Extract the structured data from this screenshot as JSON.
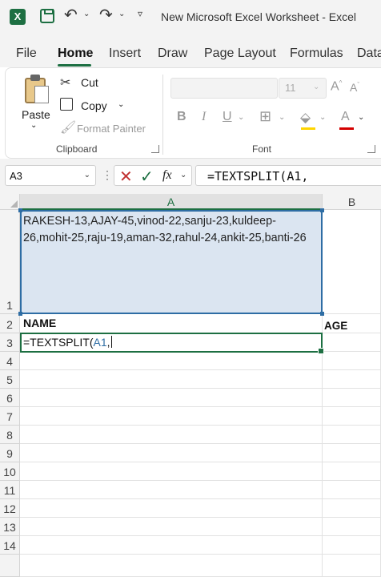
{
  "titlebar": {
    "title": "New Microsoft Excel Worksheet  -  Excel",
    "logo_letter": "X"
  },
  "tabs": [
    {
      "label": "File"
    },
    {
      "label": "Home",
      "active": true
    },
    {
      "label": "Insert"
    },
    {
      "label": "Draw"
    },
    {
      "label": "Page Layout"
    },
    {
      "label": "Formulas"
    },
    {
      "label": "Data"
    }
  ],
  "ribbon": {
    "clipboard": {
      "paste_label": "Paste",
      "cut_label": "Cut",
      "copy_label": "Copy",
      "format_painter_label": "Format Painter",
      "group_label": "Clipboard"
    },
    "font": {
      "font_name": "",
      "font_size": "11",
      "bold_label": "B",
      "italic_label": "I",
      "underline_label": "U",
      "font_color_label": "A",
      "group_label": "Font"
    },
    "colors": {
      "accent": "#1d6f42",
      "highlight": "#ffd500",
      "font_color": "#d40000"
    }
  },
  "formula_bar": {
    "name_box": "A3",
    "formula": "=TEXTSPLIT(A1,"
  },
  "sheet": {
    "columns": [
      "A",
      "B"
    ],
    "rows": [
      "1",
      "2",
      "3",
      "4",
      "5",
      "6",
      "7",
      "8",
      "9",
      "10",
      "11",
      "12",
      "13",
      "14"
    ],
    "cells": {
      "A1": "RAKESH-13,AJAY-45,vinod-22,sanju-23,kuldeep-26,mohit-25,raju-19,aman-32,rahul-24,ankit-25,banti-26",
      "A2": "NAME",
      "B2": "AGE",
      "A3_prefix": "=TEXTSPLIT(",
      "A3_ref": "A1",
      "A3_suffix": ","
    }
  }
}
